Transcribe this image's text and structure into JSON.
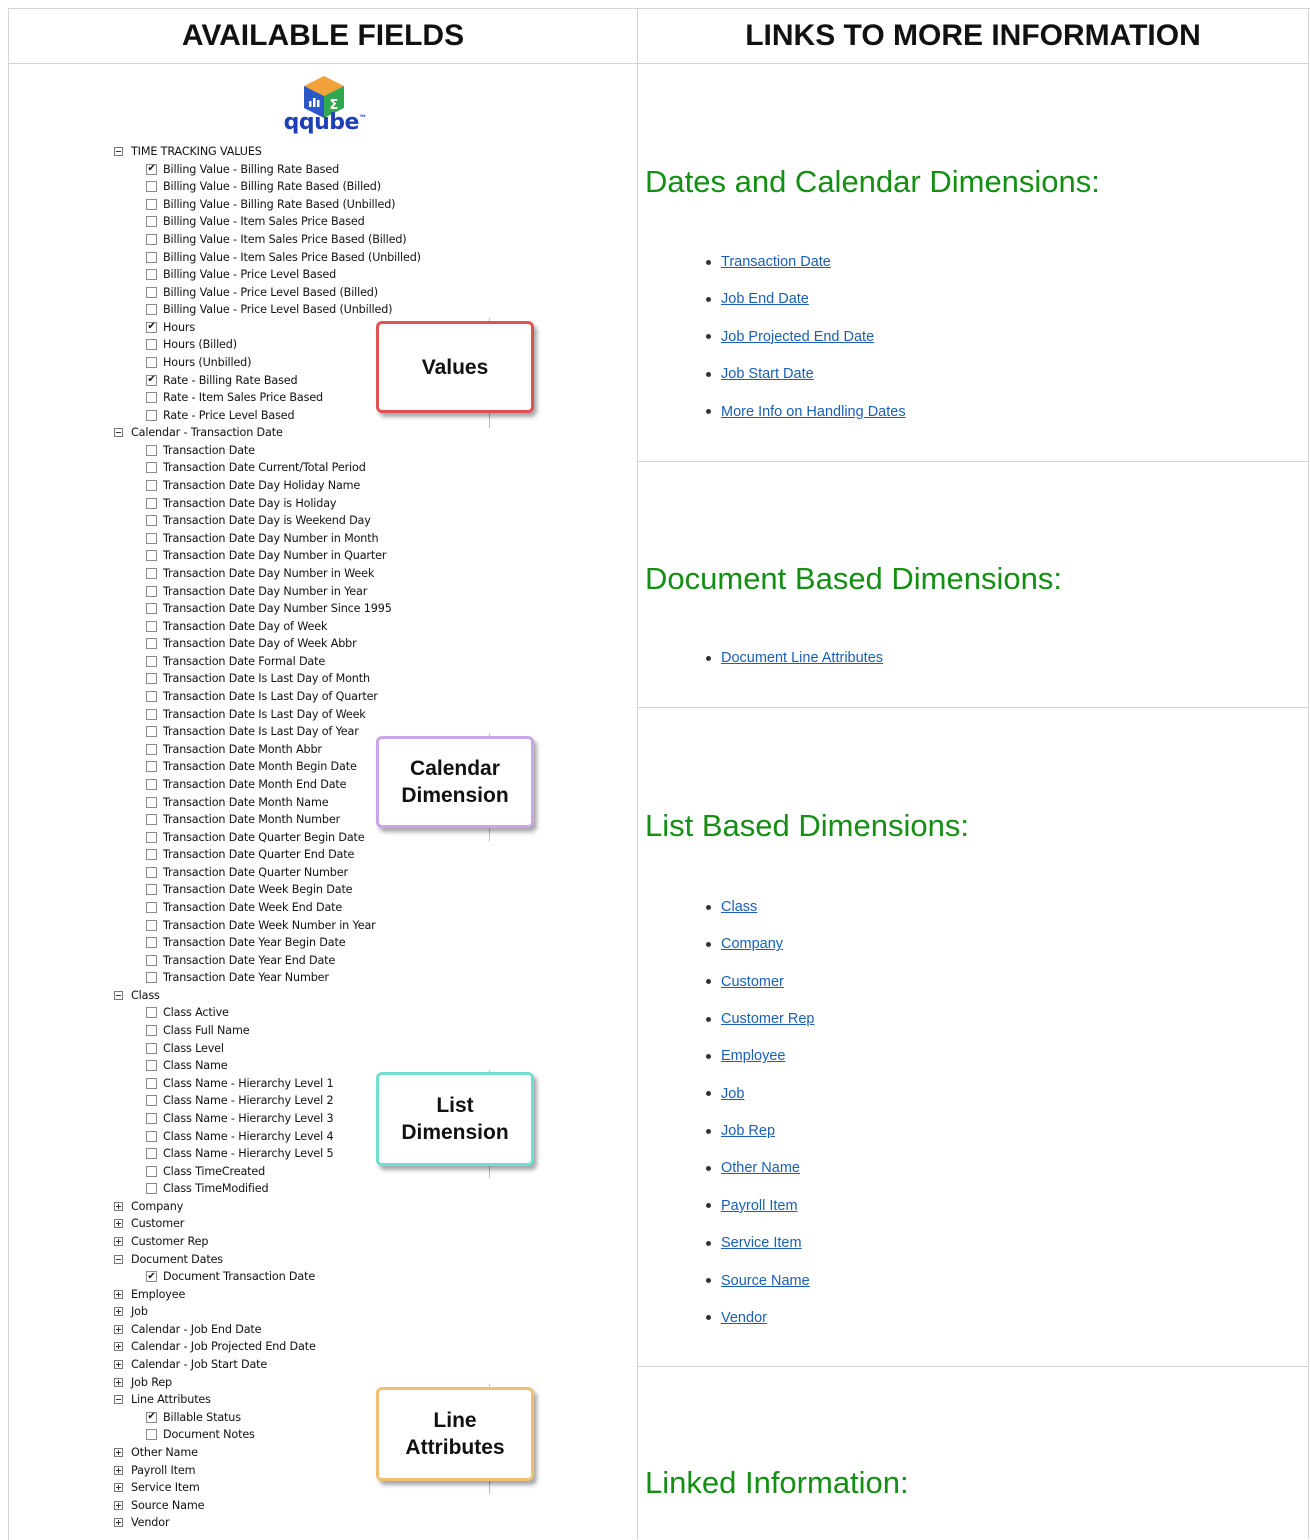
{
  "headers": {
    "left": "AVAILABLE FIELDS",
    "right": "LINKS TO MORE INFORMATION"
  },
  "logo": {
    "text": "qqube",
    "tm": "™"
  },
  "tree": [
    {
      "level": 0,
      "exp": "minus",
      "label": "TIME TRACKING VALUES"
    },
    {
      "level": 1,
      "checked": true,
      "label": "Billing Value - Billing Rate Based"
    },
    {
      "level": 1,
      "checked": false,
      "label": "Billing Value - Billing Rate Based (Billed)"
    },
    {
      "level": 1,
      "checked": false,
      "label": "Billing Value - Billing Rate Based (Unbilled)"
    },
    {
      "level": 1,
      "checked": false,
      "label": "Billing Value - Item Sales Price Based"
    },
    {
      "level": 1,
      "checked": false,
      "label": "Billing Value - Item Sales Price Based (Billed)"
    },
    {
      "level": 1,
      "checked": false,
      "label": "Billing Value - Item Sales Price Based (Unbilled)"
    },
    {
      "level": 1,
      "checked": false,
      "label": "Billing Value - Price Level Based"
    },
    {
      "level": 1,
      "checked": false,
      "label": "Billing Value - Price Level Based (Billed)"
    },
    {
      "level": 1,
      "checked": false,
      "label": "Billing Value - Price Level Based (Unbilled)"
    },
    {
      "level": 1,
      "checked": true,
      "label": "Hours"
    },
    {
      "level": 1,
      "checked": false,
      "label": "Hours (Billed)"
    },
    {
      "level": 1,
      "checked": false,
      "label": "Hours (Unbilled)"
    },
    {
      "level": 1,
      "checked": true,
      "label": "Rate - Billing Rate Based"
    },
    {
      "level": 1,
      "checked": false,
      "label": "Rate - Item Sales Price Based"
    },
    {
      "level": 1,
      "checked": false,
      "label": "Rate - Price Level Based"
    },
    {
      "level": 0,
      "exp": "minus",
      "label": "Calendar - Transaction Date"
    },
    {
      "level": 1,
      "checked": false,
      "label": "Transaction Date"
    },
    {
      "level": 1,
      "checked": false,
      "label": "Transaction Date Current/Total Period"
    },
    {
      "level": 1,
      "checked": false,
      "label": "Transaction Date Day Holiday Name"
    },
    {
      "level": 1,
      "checked": false,
      "label": "Transaction Date Day is Holiday"
    },
    {
      "level": 1,
      "checked": false,
      "label": "Transaction Date Day is Weekend Day"
    },
    {
      "level": 1,
      "checked": false,
      "label": "Transaction Date Day Number in Month"
    },
    {
      "level": 1,
      "checked": false,
      "label": "Transaction Date Day Number in Quarter"
    },
    {
      "level": 1,
      "checked": false,
      "label": "Transaction Date Day Number in Week"
    },
    {
      "level": 1,
      "checked": false,
      "label": "Transaction Date Day Number in Year"
    },
    {
      "level": 1,
      "checked": false,
      "label": "Transaction Date Day Number Since 1995"
    },
    {
      "level": 1,
      "checked": false,
      "label": "Transaction Date Day of Week"
    },
    {
      "level": 1,
      "checked": false,
      "label": "Transaction Date Day of Week Abbr"
    },
    {
      "level": 1,
      "checked": false,
      "label": "Transaction Date Formal Date"
    },
    {
      "level": 1,
      "checked": false,
      "label": "Transaction Date Is Last Day of Month"
    },
    {
      "level": 1,
      "checked": false,
      "label": "Transaction Date Is Last Day of Quarter"
    },
    {
      "level": 1,
      "checked": false,
      "label": "Transaction Date Is Last Day of Week"
    },
    {
      "level": 1,
      "checked": false,
      "label": "Transaction Date Is Last Day of Year"
    },
    {
      "level": 1,
      "checked": false,
      "label": "Transaction Date Month Abbr"
    },
    {
      "level": 1,
      "checked": false,
      "label": "Transaction Date Month Begin Date"
    },
    {
      "level": 1,
      "checked": false,
      "label": "Transaction Date Month End Date"
    },
    {
      "level": 1,
      "checked": false,
      "label": "Transaction Date Month Name"
    },
    {
      "level": 1,
      "checked": false,
      "label": "Transaction Date Month Number"
    },
    {
      "level": 1,
      "checked": false,
      "label": "Transaction Date Quarter Begin Date"
    },
    {
      "level": 1,
      "checked": false,
      "label": "Transaction Date Quarter End Date"
    },
    {
      "level": 1,
      "checked": false,
      "label": "Transaction Date Quarter Number"
    },
    {
      "level": 1,
      "checked": false,
      "label": "Transaction Date Week Begin Date"
    },
    {
      "level": 1,
      "checked": false,
      "label": "Transaction Date Week End Date"
    },
    {
      "level": 1,
      "checked": false,
      "label": "Transaction Date Week Number in Year"
    },
    {
      "level": 1,
      "checked": false,
      "label": "Transaction Date Year Begin Date"
    },
    {
      "level": 1,
      "checked": false,
      "label": "Transaction Date Year End Date"
    },
    {
      "level": 1,
      "checked": false,
      "label": "Transaction Date Year Number"
    },
    {
      "level": 0,
      "exp": "minus",
      "label": "Class"
    },
    {
      "level": 1,
      "checked": false,
      "label": "Class Active"
    },
    {
      "level": 1,
      "checked": false,
      "label": "Class Full Name"
    },
    {
      "level": 1,
      "checked": false,
      "label": "Class Level"
    },
    {
      "level": 1,
      "checked": false,
      "label": "Class Name"
    },
    {
      "level": 1,
      "checked": false,
      "label": "Class Name - Hierarchy Level 1"
    },
    {
      "level": 1,
      "checked": false,
      "label": "Class Name - Hierarchy Level 2"
    },
    {
      "level": 1,
      "checked": false,
      "label": "Class Name - Hierarchy Level 3"
    },
    {
      "level": 1,
      "checked": false,
      "label": "Class Name - Hierarchy Level 4"
    },
    {
      "level": 1,
      "checked": false,
      "label": "Class Name - Hierarchy Level 5"
    },
    {
      "level": 1,
      "checked": false,
      "label": "Class TimeCreated"
    },
    {
      "level": 1,
      "checked": false,
      "label": "Class TimeModified"
    },
    {
      "level": 0,
      "exp": "plus",
      "label": "Company"
    },
    {
      "level": 0,
      "exp": "plus",
      "label": "Customer"
    },
    {
      "level": 0,
      "exp": "plus",
      "label": "Customer Rep"
    },
    {
      "level": 0,
      "exp": "minus",
      "label": "Document Dates"
    },
    {
      "level": 1,
      "checked": true,
      "label": "Document Transaction Date"
    },
    {
      "level": 0,
      "exp": "plus",
      "label": "Employee"
    },
    {
      "level": 0,
      "exp": "plus",
      "label": "Job"
    },
    {
      "level": 0,
      "exp": "plus",
      "label": "Calendar - Job End Date"
    },
    {
      "level": 0,
      "exp": "plus",
      "label": "Calendar - Job Projected End Date"
    },
    {
      "level": 0,
      "exp": "plus",
      "label": "Calendar - Job Start Date"
    },
    {
      "level": 0,
      "exp": "plus",
      "label": "Job Rep"
    },
    {
      "level": 0,
      "exp": "minus",
      "label": "Line Attributes"
    },
    {
      "level": 1,
      "checked": true,
      "label": "Billable Status"
    },
    {
      "level": 1,
      "checked": false,
      "label": "Document Notes"
    },
    {
      "level": 0,
      "exp": "plus",
      "label": "Other Name"
    },
    {
      "level": 0,
      "exp": "plus",
      "label": "Payroll Item"
    },
    {
      "level": 0,
      "exp": "plus",
      "label": "Service Item"
    },
    {
      "level": 0,
      "exp": "plus",
      "label": "Source Name"
    },
    {
      "level": 0,
      "exp": "plus",
      "label": "Vendor"
    }
  ],
  "callouts": [
    {
      "name": "values",
      "text": "Values",
      "color": "#e05252"
    },
    {
      "name": "calendar-dimension",
      "text": "Calendar\nDimension",
      "color": "#c9a6e6"
    },
    {
      "name": "list-dimension",
      "text": "List\nDimension",
      "color": "#6fe0cf"
    },
    {
      "name": "line-attributes",
      "text": "Line\nAttributes",
      "color": "#f0c070"
    }
  ],
  "sections": [
    {
      "name": "dates",
      "title": "Dates and Calendar Dimensions:",
      "links": [
        "Transaction Date",
        "Job End Date",
        "Job Projected End Date",
        "Job Start Date",
        "More Info on Handling Dates"
      ]
    },
    {
      "name": "document",
      "title": "Document Based Dimensions:",
      "links": [
        "Document Line Attributes"
      ]
    },
    {
      "name": "list",
      "title": "List Based Dimensions:",
      "links": [
        "Class",
        "Company",
        "Customer",
        "Customer Rep",
        "Employee",
        "Job",
        "Job Rep",
        "Other Name",
        "Payroll Item",
        "Service Item",
        "Source Name",
        "Vendor"
      ]
    },
    {
      "name": "linked",
      "title": "Linked Information:",
      "links": []
    }
  ],
  "colors": {
    "section_title": "#148f14",
    "link": "#1a5fb4"
  }
}
